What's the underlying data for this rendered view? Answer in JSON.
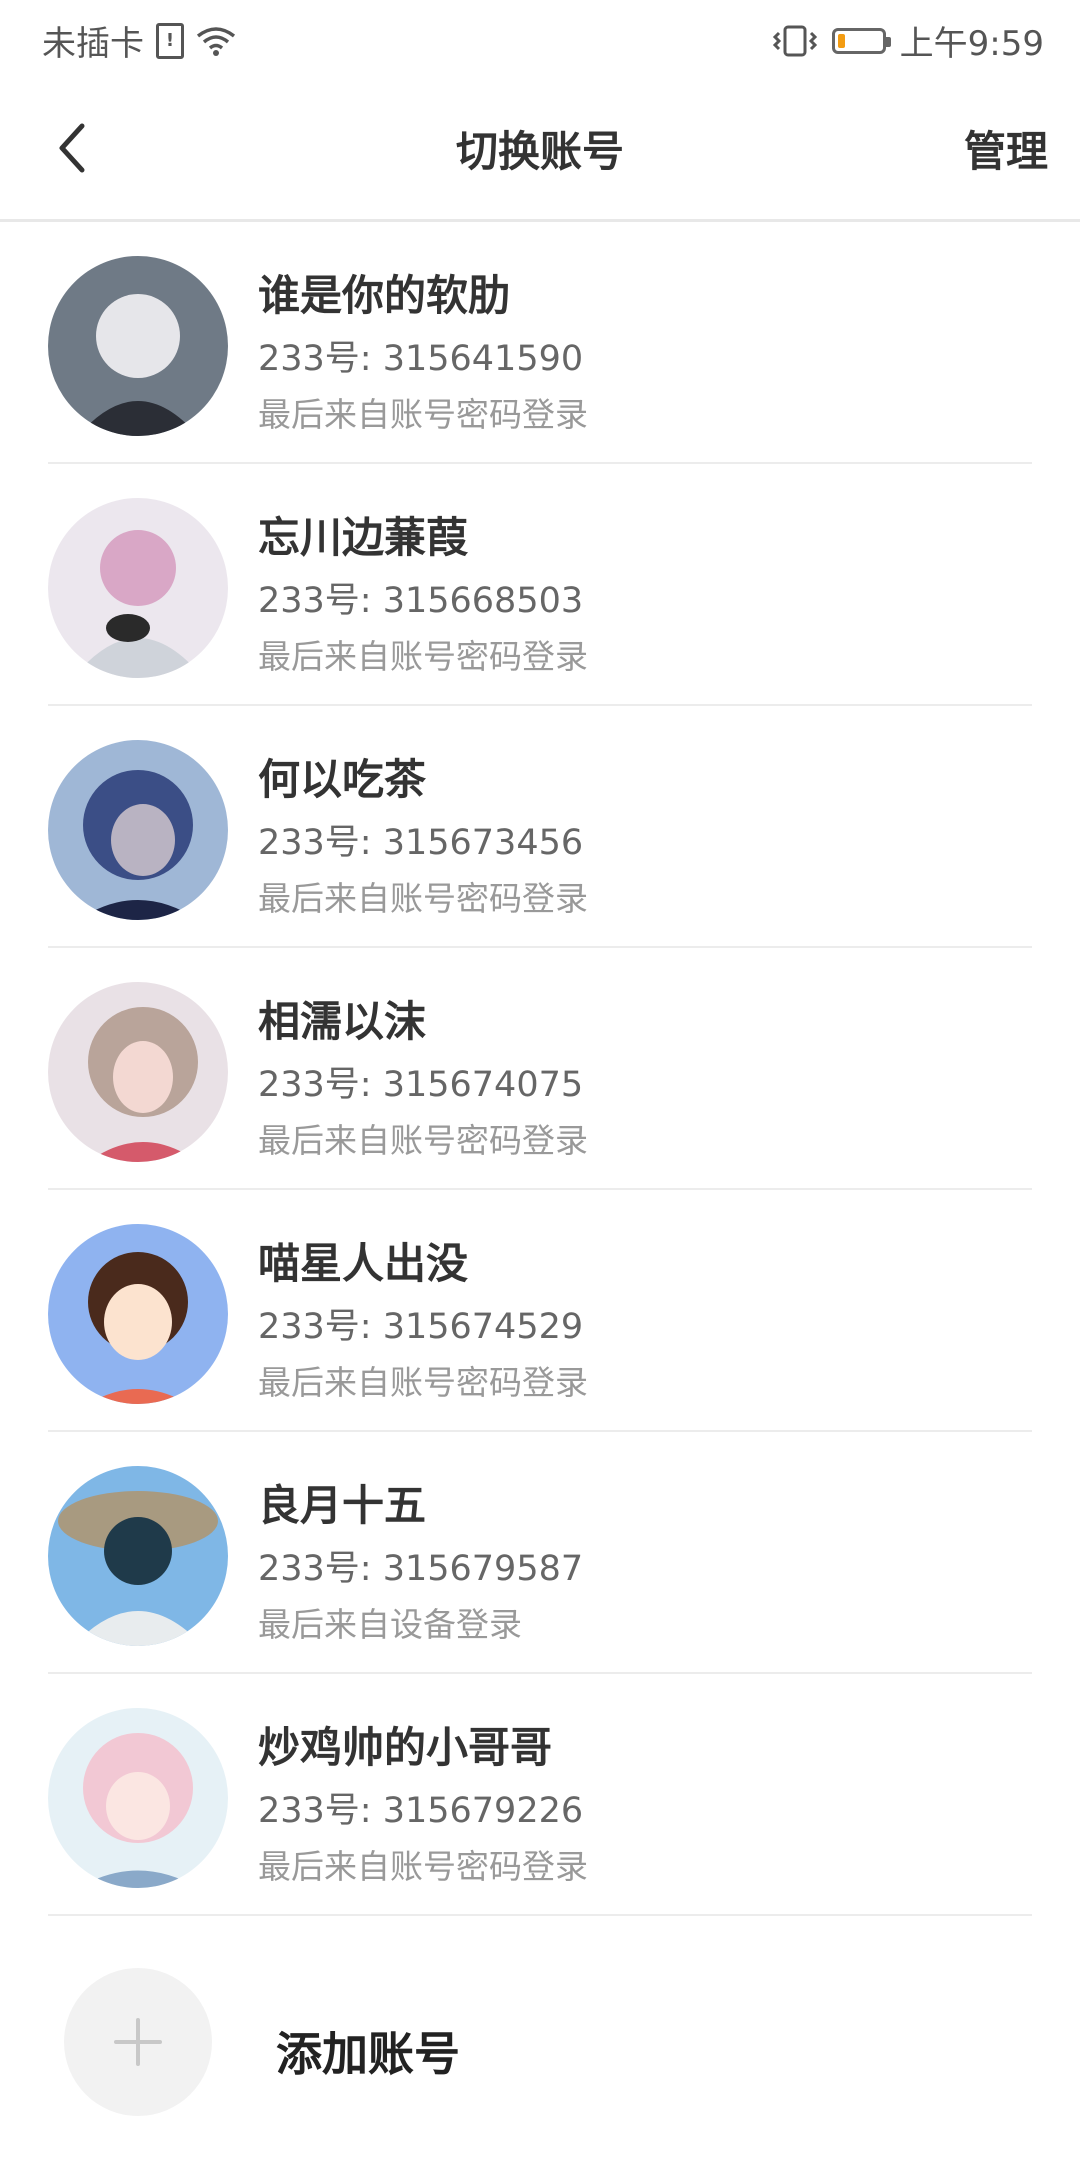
{
  "status_bar": {
    "carrier": "未插卡",
    "time": "上午9:59",
    "battery_level": 0.15,
    "icons": [
      "sim-alert-icon",
      "wifi-icon",
      "vibrate-icon",
      "battery-icon"
    ]
  },
  "header": {
    "back_icon": "chevron-left-icon",
    "title": "切换账号",
    "manage_label": "管理"
  },
  "accounts": [
    {
      "name": "谁是你的软肋",
      "uid": "233号: 315641590",
      "last_login": "最后来自账号密码登录",
      "avatar_colors": [
        "#6f7a86",
        "#e6e6ea",
        "#2b2e36"
      ]
    },
    {
      "name": "忘川边蒹葭",
      "uid": "233号: 315668503",
      "last_login": "最后来自账号密码登录",
      "avatar_colors": [
        "#d9a7c6",
        "#cfd3da",
        "#2a2a2a"
      ]
    },
    {
      "name": "何以吃茶",
      "uid": "233号: 315673456",
      "last_login": "最后来自账号密码登录",
      "avatar_colors": [
        "#3b4e86",
        "#9fb7d6",
        "#1d2546"
      ]
    },
    {
      "name": "相濡以沫",
      "uid": "233号: 315674075",
      "last_login": "最后来自账号密码登录",
      "avatar_colors": [
        "#b9a49a",
        "#f3d8d2",
        "#d55a6b"
      ]
    },
    {
      "name": "喵星人出没",
      "uid": "233号: 315674529",
      "last_login": "最后来自账号密码登录",
      "avatar_colors": [
        "#8fb3f0",
        "#fce3cf",
        "#4a2a1c"
      ]
    },
    {
      "name": "良月十五",
      "uid": "233号: 315679587",
      "last_login": "最后来自设备登录",
      "avatar_colors": [
        "#7fb7e6",
        "#e8ecee",
        "#1f3a4a"
      ]
    },
    {
      "name": "炒鸡帅的小哥哥",
      "uid": "233号: 315679226",
      "last_login": "最后来自账号密码登录",
      "avatar_colors": [
        "#e6f1f6",
        "#f2c8d4",
        "#8aa9c9"
      ]
    }
  ],
  "add_account": {
    "icon": "plus-icon",
    "label": "添加账号"
  }
}
